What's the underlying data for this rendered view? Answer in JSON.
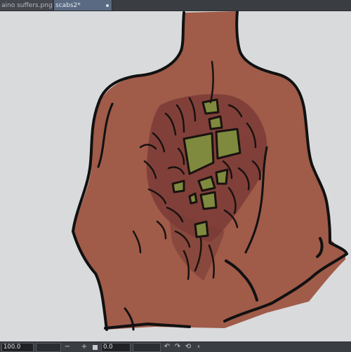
{
  "tabs": [
    {
      "label": "aino suffers.png",
      "close": "✕",
      "active": false
    },
    {
      "label": "scabs2*",
      "active": true
    }
  ],
  "status": {
    "zoom_value": "100.0",
    "rotation_value": "0.0",
    "icons": {
      "zoom_out": "minus-icon",
      "zoom_in": "plus-icon",
      "zoom_reset": "stop-square-icon",
      "rotate_left": "rotate-left-icon",
      "rotate_right": "rotate-right-icon",
      "rotate_reset": "reset-rotation-icon",
      "collapse": "chevron-left-icon"
    }
  },
  "colors": {
    "canvas_bg": "#d9dadc",
    "skin": "#a05b49",
    "wound": "#7a3c36",
    "scab_inner": "#7f8a3e",
    "ui_dark": "#3a3d42",
    "active_tab": "#5a6a82"
  }
}
